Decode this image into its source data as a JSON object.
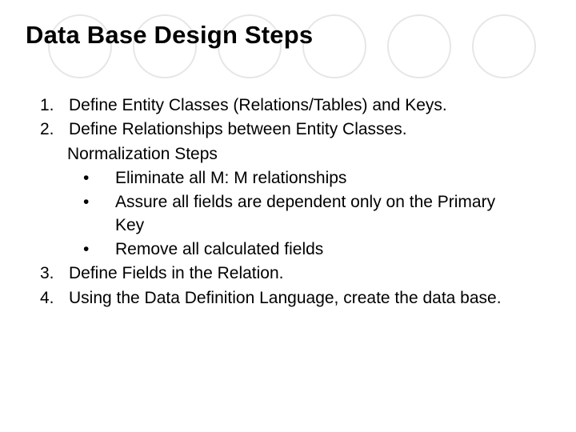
{
  "title": "Data Base Design Steps",
  "steps": {
    "n1": "1.",
    "t1": "Define Entity Classes (Relations/Tables) and Keys.",
    "n2": "2.",
    "t2": "Define Relationships between Entity Classes.",
    "normLabel": "Normalization Steps",
    "b1": "Eliminate all M: M relationships",
    "b2": "Assure all fields are dependent only on the Primary Key",
    "b3": "Remove all calculated fields",
    "n3": "3.",
    "t3": "Define Fields in the Relation.",
    "n4": "4.",
    "t4": "Using the Data Definition Language, create the data base."
  },
  "bulletChar": "•"
}
